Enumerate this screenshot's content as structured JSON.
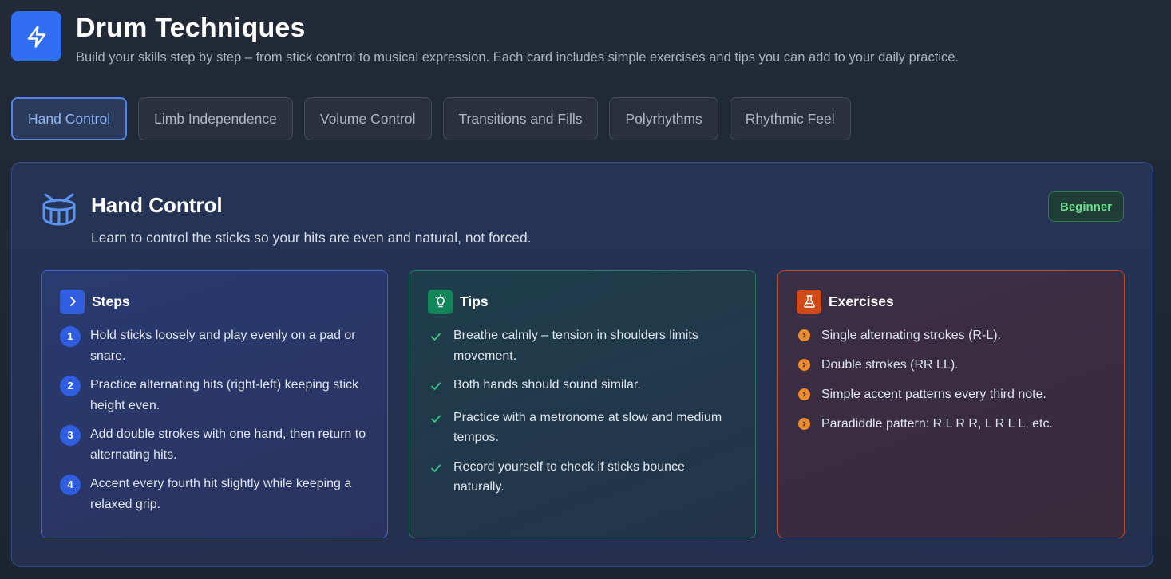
{
  "header": {
    "title": "Drum Techniques",
    "subtitle": "Build your skills step by step – from stick control to musical expression. Each card includes simple exercises and tips you can add to your daily practice.",
    "logo_icon": "lightning-icon"
  },
  "tabs": [
    {
      "label": "Hand Control",
      "active": true
    },
    {
      "label": "Limb Independence",
      "active": false
    },
    {
      "label": "Volume Control",
      "active": false
    },
    {
      "label": "Transitions and Fills",
      "active": false
    },
    {
      "label": "Polyrhythms",
      "active": false
    },
    {
      "label": "Rhythmic Feel",
      "active": false
    }
  ],
  "panel": {
    "icon": "drum-icon",
    "title": "Hand Control",
    "description": "Learn to control the sticks so your hits are even and natural, not forced.",
    "badge": "Beginner",
    "steps": {
      "title": "Steps",
      "icon": "chevron-right-icon",
      "items": [
        {
          "num": "1",
          "text": "Hold sticks loosely and play evenly on a pad or snare."
        },
        {
          "num": "2",
          "text": "Practice alternating hits (right-left) keeping stick height even."
        },
        {
          "num": "3",
          "text": "Add double strokes with one hand, then return to alternating hits."
        },
        {
          "num": "4",
          "text": "Accent every fourth hit slightly while keeping a relaxed grip."
        }
      ]
    },
    "tips": {
      "title": "Tips",
      "icon": "lightbulb-icon",
      "items": [
        "Breathe calmly – tension in shoulders limits movement.",
        "Both hands should sound similar.",
        "Practice with a metronome at slow and medium tempos.",
        "Record yourself to check if sticks bounce naturally."
      ]
    },
    "exercises": {
      "title": "Exercises",
      "icon": "flask-icon",
      "items": [
        "Single alternating strokes (R-L).",
        "Double strokes (RR LL).",
        "Simple accent patterns every third note.",
        "Paradiddle pattern: R L R R, L R L L, etc."
      ]
    }
  },
  "colors": {
    "accent": "#2f6df2",
    "badge_green": "#6ee08f",
    "steps_blue": "#2f5ee0",
    "tips_green": "#13855a",
    "exercises_orange": "#d24a17"
  }
}
